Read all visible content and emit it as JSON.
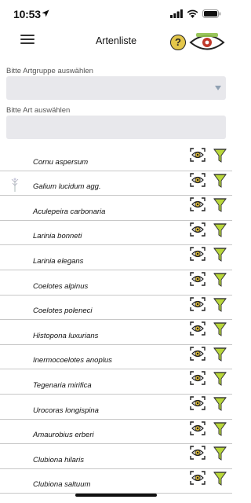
{
  "status_bar": {
    "time": "10:53"
  },
  "header": {
    "title": "Artenliste",
    "help_symbol": "?"
  },
  "filters": {
    "group_label": "Bitte Artgruppe auswählen",
    "group_value": "",
    "species_label": "Bitte Art auswählen",
    "species_value": ""
  },
  "species": [
    "Cornu aspersum",
    "Galium lucidum agg.",
    "Aculepeira carbonaria",
    "Larinia bonneti",
    "Larinia elegans",
    "Coelotes alpinus",
    "Coelotes poleneci",
    "Histopona luxurians",
    "Inermocoelotes anoplus",
    "Tegenaria mirifica",
    "Urocoras longispina",
    "Amaurobius erberi",
    "Clubiona hilaris",
    "Clubiona saltuum"
  ],
  "icons": {
    "location": "location-arrow-icon",
    "signal": "signal-icon",
    "wifi": "wifi-icon",
    "battery": "battery-icon",
    "menu": "menu-icon",
    "help": "help-icon",
    "eye": "eye-scan-icon",
    "filter": "filter-funnel-icon"
  },
  "colors": {
    "accent_yellow": "#e4c74b",
    "funnel_green": "#b9d83a",
    "logo_red": "#c0392b"
  }
}
